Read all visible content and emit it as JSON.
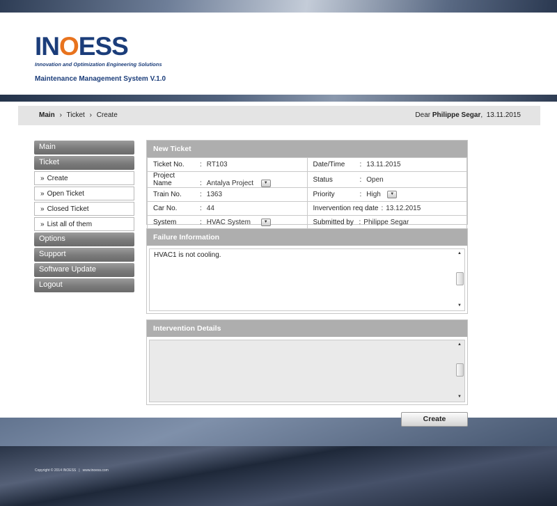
{
  "header": {
    "logo_prefix": "IN",
    "logo_o": "O",
    "logo_suffix": "ESS",
    "tagline": "Innovation and Optimization Engineering Solutions",
    "system_name": "Maintenance Management System V.1.0"
  },
  "breadcrumb": {
    "items": [
      "Main",
      "Ticket",
      "Create"
    ],
    "separator": "›"
  },
  "greeting": {
    "prefix": "Dear",
    "user": "Philippe Segar",
    "date": "13.11.2015"
  },
  "sidebar": {
    "main": "Main",
    "ticket": "Ticket",
    "sub_items": [
      "Create",
      "Open Ticket",
      "Closed Ticket",
      "List all of them"
    ],
    "sub_arrow": "»",
    "options": "Options",
    "support": "Support",
    "software_update": "Software Update",
    "logout": "Logout"
  },
  "ticket_panel": {
    "title": "New Ticket",
    "colon": ":",
    "left": [
      {
        "label": "Ticket No.",
        "value": "RT103"
      },
      {
        "label": "Project Name",
        "value": "Antalya Project"
      },
      {
        "label": "Train No.",
        "value": "1363"
      },
      {
        "label": "Car No.",
        "value": "44"
      },
      {
        "label": "System",
        "value": "HVAC System"
      }
    ],
    "right": [
      {
        "label": "Date/Time",
        "value": "13.11.2015"
      },
      {
        "label": "Status",
        "value": "Open"
      },
      {
        "label": "Priority",
        "value": "High"
      },
      {
        "label": "Invervention req date",
        "value": "13.12.2015"
      },
      {
        "label": "Submitted by",
        "value": "Philippe Segar"
      }
    ]
  },
  "failure_panel": {
    "title": "Failure Information",
    "text": "HVAC1 is not cooling."
  },
  "intervention_panel": {
    "title": "Intervention Details",
    "text": ""
  },
  "create_button": "Create",
  "footer": {
    "copyright": "Copyright © 2014 INOESS",
    "url": "www.inoess.com"
  },
  "icons": {
    "dropdown": "chevron-down-icon",
    "scroll_up": "arrow-up-icon",
    "scroll_down": "arrow-down-icon"
  }
}
